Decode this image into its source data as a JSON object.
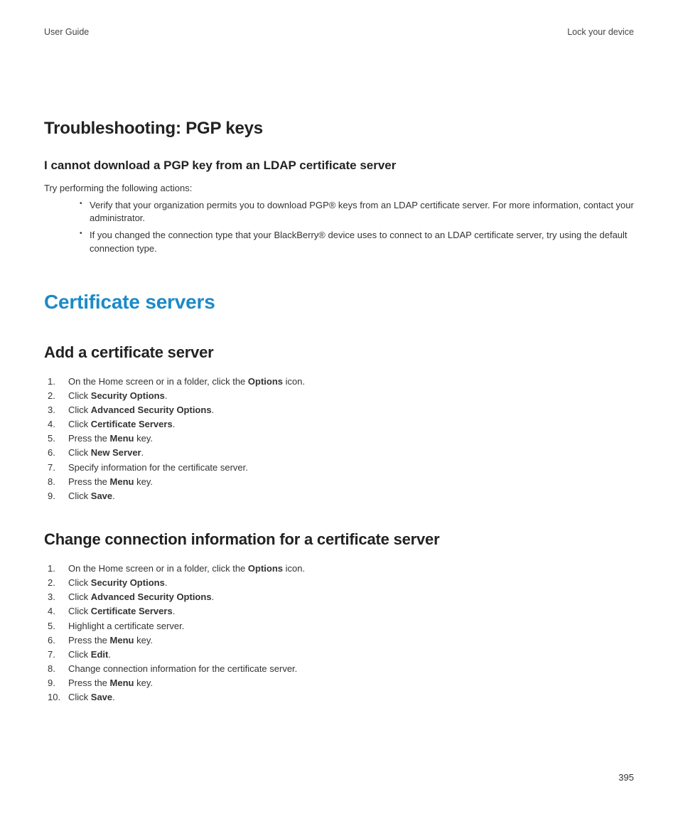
{
  "header": {
    "left": "User Guide",
    "right": "Lock your device"
  },
  "troubleshooting": {
    "title": "Troubleshooting: PGP keys",
    "subtitle": "I cannot download a PGP key from an LDAP certificate server",
    "intro": "Try performing the following actions:",
    "bullets": [
      "Verify that your organization permits you to download PGP® keys from an LDAP certificate server. For more information, contact your administrator.",
      "If you changed the connection type that your BlackBerry® device uses to connect to an LDAP certificate server, try using the default connection type."
    ]
  },
  "certServers": {
    "title": "Certificate servers",
    "add": {
      "title": "Add a certificate server",
      "steps": [
        {
          "pre": "On the Home screen or in a folder, click the ",
          "bold": "Options",
          "post": " icon."
        },
        {
          "pre": "Click ",
          "bold": "Security Options",
          "post": "."
        },
        {
          "pre": "Click ",
          "bold": "Advanced Security Options",
          "post": "."
        },
        {
          "pre": "Click ",
          "bold": "Certificate Servers",
          "post": "."
        },
        {
          "pre": "Press the ",
          "bold": "Menu",
          "post": " key."
        },
        {
          "pre": "Click ",
          "bold": "New Server",
          "post": "."
        },
        {
          "pre": "Specify information for the certificate server.",
          "bold": "",
          "post": ""
        },
        {
          "pre": "Press the ",
          "bold": "Menu",
          "post": " key."
        },
        {
          "pre": "Click ",
          "bold": "Save",
          "post": "."
        }
      ]
    },
    "change": {
      "title": "Change connection information for a certificate server",
      "steps": [
        {
          "pre": "On the Home screen or in a folder, click the ",
          "bold": "Options",
          "post": " icon."
        },
        {
          "pre": "Click ",
          "bold": "Security Options",
          "post": "."
        },
        {
          "pre": "Click ",
          "bold": "Advanced Security Options",
          "post": "."
        },
        {
          "pre": "Click ",
          "bold": "Certificate Servers",
          "post": "."
        },
        {
          "pre": "Highlight a certificate server.",
          "bold": "",
          "post": ""
        },
        {
          "pre": "Press the ",
          "bold": "Menu",
          "post": " key."
        },
        {
          "pre": "Click ",
          "bold": "Edit",
          "post": "."
        },
        {
          "pre": "Change connection information for the certificate server.",
          "bold": "",
          "post": ""
        },
        {
          "pre": "Press the ",
          "bold": "Menu",
          "post": " key."
        },
        {
          "pre": "Click ",
          "bold": "Save",
          "post": "."
        }
      ]
    }
  },
  "pageNumber": "395"
}
